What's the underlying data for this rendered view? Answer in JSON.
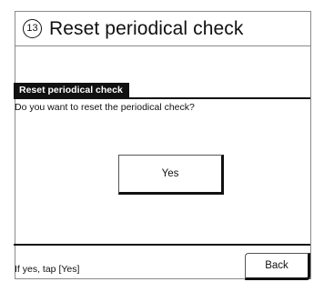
{
  "title_bar": {
    "step_number": "13",
    "title": "Reset periodical check"
  },
  "screen": {
    "header_label": "Reset periodical check",
    "question": "Do you want to reset the periodical check?",
    "yes_label": "Yes",
    "footer_hint": "If yes, tap [Yes]",
    "back_label": "Back"
  }
}
